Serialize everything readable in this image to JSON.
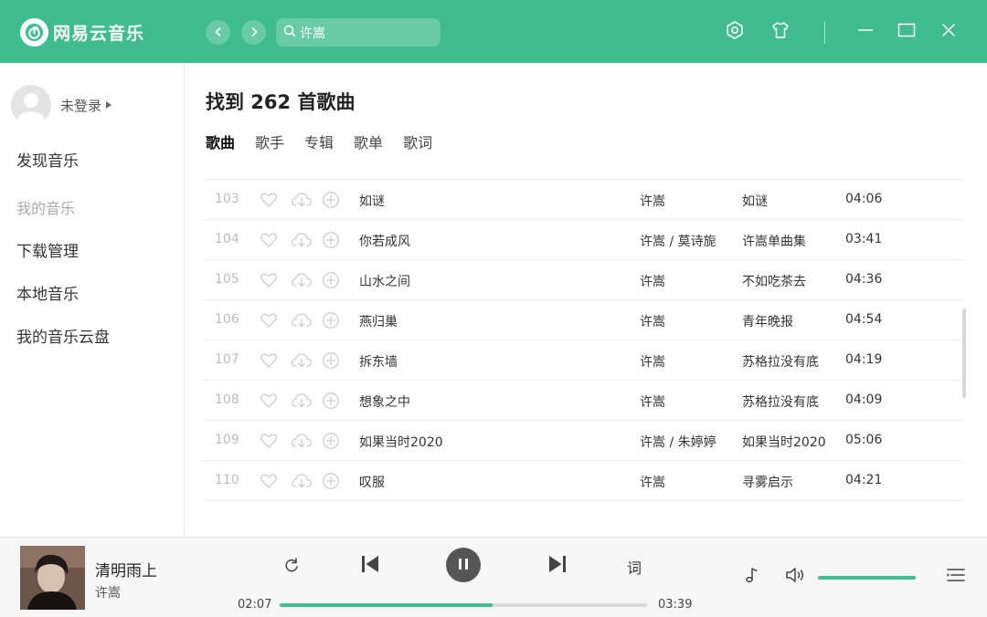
{
  "app": {
    "name": "网易云音乐",
    "accent_color": "#3fbd8f"
  },
  "header": {
    "back_icon": "chevron-left-icon",
    "forward_icon": "chevron-right-icon",
    "search": {
      "value": "许嵩",
      "icon": "search-icon"
    },
    "icons": [
      "settings-icon",
      "skin-icon",
      "minimize-icon",
      "maximize-icon",
      "close-icon"
    ]
  },
  "sidebar": {
    "user": {
      "name": "未登录"
    },
    "discover": "发现音乐",
    "section_label": "我的音乐",
    "items": [
      {
        "label": "下载管理"
      },
      {
        "label": "本地音乐"
      },
      {
        "label": "我的音乐云盘"
      }
    ]
  },
  "main": {
    "result_title": "找到 262 首歌曲",
    "tabs": [
      {
        "label": "歌曲",
        "active": true
      },
      {
        "label": "歌手",
        "active": false
      },
      {
        "label": "专辑",
        "active": false
      },
      {
        "label": "歌单",
        "active": false
      },
      {
        "label": "歌词",
        "active": false
      }
    ],
    "songs": [
      {
        "num": "103",
        "title": "如谜",
        "artist": "许嵩",
        "album": "如谜",
        "duration": "04:06"
      },
      {
        "num": "104",
        "title": "你若成风",
        "artist": "许嵩 / 莫诗旎",
        "album": "许嵩单曲集",
        "duration": "03:41"
      },
      {
        "num": "105",
        "title": "山水之间",
        "artist": "许嵩",
        "album": "不如吃茶去",
        "duration": "04:36"
      },
      {
        "num": "106",
        "title": "燕归巢",
        "artist": "许嵩",
        "album": "青年晚报",
        "duration": "04:54"
      },
      {
        "num": "107",
        "title": "拆东墙",
        "artist": "许嵩",
        "album": "苏格拉没有底",
        "duration": "04:19"
      },
      {
        "num": "108",
        "title": "想象之中",
        "artist": "许嵩",
        "album": "苏格拉没有底",
        "duration": "04:09"
      },
      {
        "num": "109",
        "title": "如果当时2020",
        "artist": "许嵩 / 朱婷婷",
        "album": "如果当时2020",
        "duration": "05:06"
      },
      {
        "num": "110",
        "title": "叹服",
        "artist": "许嵩",
        "album": "寻雾启示",
        "duration": "04:21"
      }
    ]
  },
  "player": {
    "song_title": "清明雨上",
    "artist": "许嵩",
    "current_time": "02:07",
    "total_time": "03:39",
    "progress": 0.58,
    "volume": 1.0,
    "lyric_label": "词",
    "state": "playing"
  }
}
